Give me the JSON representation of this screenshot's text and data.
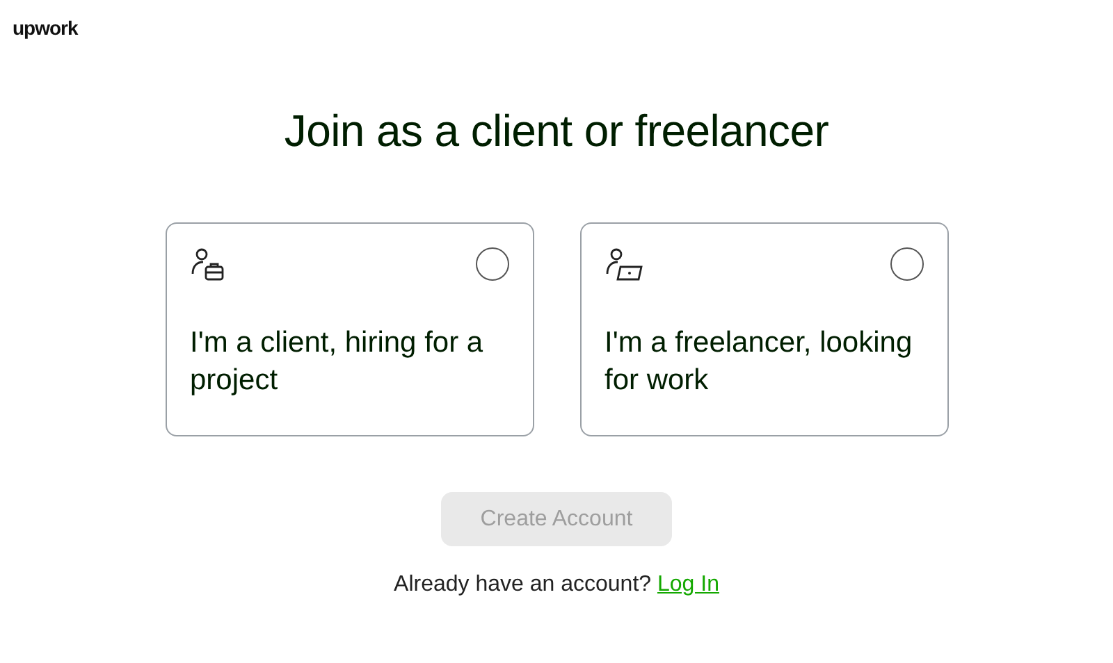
{
  "logo": "upwork",
  "title": "Join as a client or freelancer",
  "options": [
    {
      "kind": "client",
      "label": "I'm a client, hiring for a project",
      "selected": false
    },
    {
      "kind": "freelancer",
      "label": "I'm a freelancer, looking for work",
      "selected": false
    }
  ],
  "create_button": {
    "label": "Create Account",
    "disabled": true
  },
  "login_prompt": {
    "text": "Already have an account?",
    "link": "Log In"
  }
}
